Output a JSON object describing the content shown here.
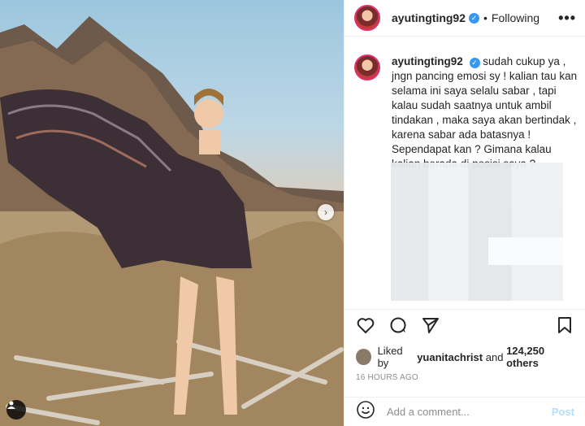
{
  "post": {
    "username": "ayutingting92",
    "follow_status": "Following",
    "separator": "•",
    "more_label": "•••",
    "caption": "sudah cukup ya , jngn pancing emosi sy ! kalian tau kan selama ini saya selalu sabar , tapi kalau sudah saatnya untuk ambil tindakan , maka saya akan bertindak , karena sabar ada batasnya ! Sependapat kan ? Gimana kalau kalian berada di posisi saya ?",
    "caption_dot": ".",
    "likes_prefix": "Liked by",
    "liker": "yuanitachrist",
    "likes_and": "and",
    "likes_count": "124,250 others",
    "timestamp": "16 HOURS AGO",
    "comment_placeholder": "Add a comment...",
    "post_label": "Post"
  },
  "icons": {
    "like": "heart-icon",
    "comment": "comment-icon",
    "share": "share-icon",
    "save": "bookmark-icon",
    "emoji": "emoji-icon",
    "verified": "verified-icon",
    "next": "chevron-right-icon",
    "tag": "user-tag-icon"
  },
  "colors": {
    "verified": "#3897f0",
    "post_disabled": "#b2dffc",
    "muted": "#8e8e8e"
  }
}
